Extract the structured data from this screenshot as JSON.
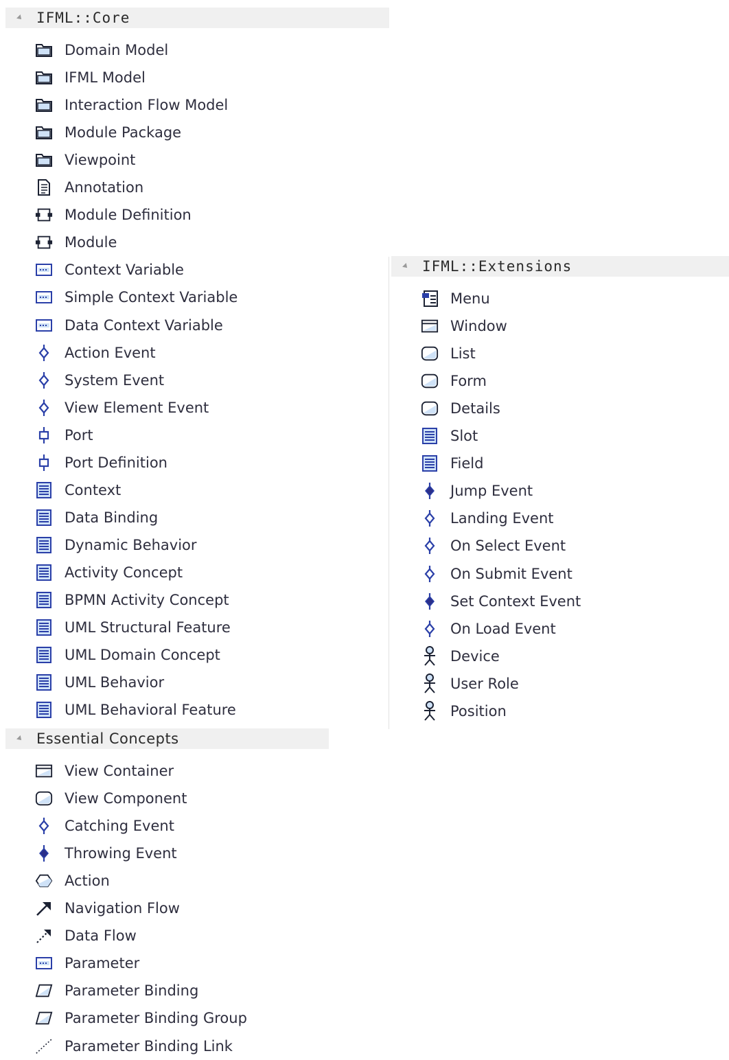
{
  "core": {
    "title": "IFML::Core",
    "items": [
      {
        "label": "Domain Model",
        "icon": "package-icon"
      },
      {
        "label": "IFML Model",
        "icon": "package-icon"
      },
      {
        "label": "Interaction Flow Model",
        "icon": "package-icon"
      },
      {
        "label": "Module Package",
        "icon": "package-icon"
      },
      {
        "label": "Viewpoint",
        "icon": "package-icon"
      },
      {
        "label": "Annotation",
        "icon": "note-icon"
      },
      {
        "label": "Module Definition",
        "icon": "component-icon"
      },
      {
        "label": "Module",
        "icon": "component-icon"
      },
      {
        "label": "Context Variable",
        "icon": "variable-icon"
      },
      {
        "label": "Simple Context Variable",
        "icon": "variable-icon"
      },
      {
        "label": "Data Context Variable",
        "icon": "variable-icon"
      },
      {
        "label": "Action Event",
        "icon": "catching-event-icon"
      },
      {
        "label": "System Event",
        "icon": "catching-event-icon"
      },
      {
        "label": "View Element Event",
        "icon": "catching-event-icon"
      },
      {
        "label": "Port",
        "icon": "port-icon"
      },
      {
        "label": "Port Definition",
        "icon": "port-icon"
      },
      {
        "label": "Context",
        "icon": "class-icon"
      },
      {
        "label": "Data Binding",
        "icon": "class-icon"
      },
      {
        "label": "Dynamic Behavior",
        "icon": "class-icon"
      },
      {
        "label": "Activity Concept",
        "icon": "class-icon"
      },
      {
        "label": "BPMN Activity Concept",
        "icon": "class-icon"
      },
      {
        "label": "UML Structural Feature",
        "icon": "class-icon"
      },
      {
        "label": "UML Domain Concept",
        "icon": "class-icon"
      },
      {
        "label": "UML Behavior",
        "icon": "class-icon"
      },
      {
        "label": "UML Behavioral Feature",
        "icon": "class-icon"
      }
    ]
  },
  "extensions": {
    "title": "IFML::Extensions",
    "items": [
      {
        "label": "Menu",
        "icon": "menu-icon"
      },
      {
        "label": "Window",
        "icon": "window-icon"
      },
      {
        "label": "List",
        "icon": "view-component-icon"
      },
      {
        "label": "Form",
        "icon": "view-component-icon"
      },
      {
        "label": "Details",
        "icon": "view-component-icon"
      },
      {
        "label": "Slot",
        "icon": "class-icon"
      },
      {
        "label": "Field",
        "icon": "class-icon"
      },
      {
        "label": "Jump Event",
        "icon": "throwing-event-icon"
      },
      {
        "label": "Landing Event",
        "icon": "catching-event-icon"
      },
      {
        "label": "On Select Event",
        "icon": "catching-event-icon"
      },
      {
        "label": "On Submit Event",
        "icon": "catching-event-icon"
      },
      {
        "label": "Set Context Event",
        "icon": "throwing-event-icon"
      },
      {
        "label": "On Load Event",
        "icon": "catching-event-icon"
      },
      {
        "label": "Device",
        "icon": "actor-icon"
      },
      {
        "label": "User Role",
        "icon": "actor-icon"
      },
      {
        "label": "Position",
        "icon": "actor-icon"
      }
    ]
  },
  "essential": {
    "title": "Essential Concepts",
    "items": [
      {
        "label": "View Container",
        "icon": "window-icon"
      },
      {
        "label": "View Component",
        "icon": "view-component-icon"
      },
      {
        "label": "Catching Event",
        "icon": "catching-event-icon"
      },
      {
        "label": "Throwing Event",
        "icon": "throwing-event-icon"
      },
      {
        "label": "Action",
        "icon": "action-icon"
      },
      {
        "label": "Navigation Flow",
        "icon": "navigation-flow-icon"
      },
      {
        "label": "Data Flow",
        "icon": "data-flow-icon"
      },
      {
        "label": "Parameter",
        "icon": "variable-icon"
      },
      {
        "label": "Parameter Binding",
        "icon": "parameter-binding-icon"
      },
      {
        "label": "Parameter Binding Group",
        "icon": "parameter-binding-icon"
      },
      {
        "label": "Parameter Binding Link",
        "icon": "binding-link-icon"
      }
    ]
  }
}
